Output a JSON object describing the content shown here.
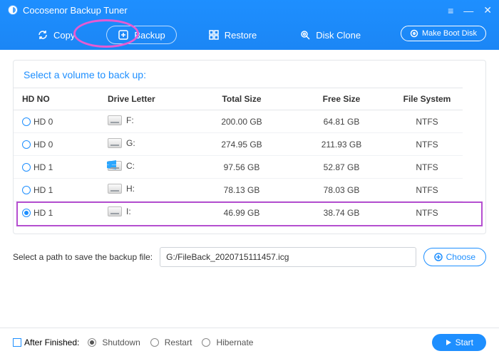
{
  "app": {
    "title": "Cocosenor Backup Tuner"
  },
  "tabs": {
    "copy": {
      "label": "Copy"
    },
    "backup": {
      "label": "Backup"
    },
    "restore": {
      "label": "Restore"
    },
    "clone": {
      "label": "Disk Clone"
    }
  },
  "buttons": {
    "make_boot": "Make Boot Disk",
    "choose": "Choose",
    "start": "Start"
  },
  "panel": {
    "title": "Select a volume to back up:",
    "headers": {
      "hd": "HD NO",
      "drive": "Drive Letter",
      "total": "Total Size",
      "free": "Free Size",
      "fs": "File System"
    },
    "rows": [
      {
        "hd": "HD 0",
        "drive": "F:",
        "total": "200.00 GB",
        "free": "64.81 GB",
        "fs": "NTFS",
        "selected": false,
        "winlogo": false
      },
      {
        "hd": "HD 0",
        "drive": "G:",
        "total": "274.95 GB",
        "free": "211.93 GB",
        "fs": "NTFS",
        "selected": false,
        "winlogo": false
      },
      {
        "hd": "HD 1",
        "drive": "C:",
        "total": "97.56 GB",
        "free": "52.87 GB",
        "fs": "NTFS",
        "selected": false,
        "winlogo": true
      },
      {
        "hd": "HD 1",
        "drive": "H:",
        "total": "78.13 GB",
        "free": "78.03 GB",
        "fs": "NTFS",
        "selected": false,
        "winlogo": false
      },
      {
        "hd": "HD 1",
        "drive": "I:",
        "total": "46.99 GB",
        "free": "38.74 GB",
        "fs": "NTFS",
        "selected": true,
        "winlogo": false
      }
    ]
  },
  "path": {
    "label": "Select a path to save the backup file:",
    "value": "G:/FileBack_2020715111457.icg"
  },
  "footer": {
    "after_label": "After Finished:",
    "opts": {
      "shutdown": "Shutdown",
      "restart": "Restart",
      "hibernate": "Hibernate"
    }
  }
}
